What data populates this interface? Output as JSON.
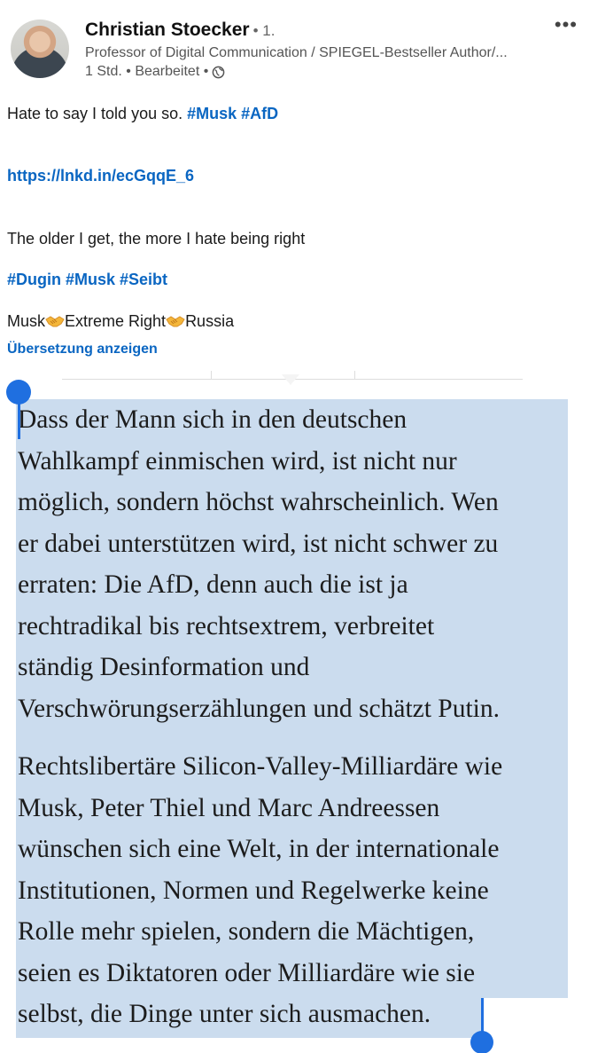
{
  "post": {
    "author_name": "Christian Stoecker",
    "degree": "• 1.",
    "headline": "Professor of Digital Communication / SPIEGEL-Bestseller Author/...",
    "time": "1 Std.",
    "separator": "•",
    "edited": "Bearbeitet",
    "separator2": "•",
    "more_label": "•••"
  },
  "body": {
    "line1_text": "Hate to say I told you so. ",
    "line1_tags": "#Musk #AfD",
    "link": "https://lnkd.in/ecGqqE_6",
    "line3": "The older I get, the more I hate being right",
    "tags2": "#Dugin #Musk #Seibt",
    "words": [
      "Musk",
      "Extreme Right",
      "Russia"
    ],
    "translate": "Übersetzung anzeigen"
  },
  "article": {
    "paragraph1": [
      "Dass der Mann sich in den deutschen",
      "Wahlkampf einmischen wird, ist nicht nur",
      "möglich, sondern höchst wahrscheinlich. Wen",
      "er dabei unterstützen wird, ist nicht schwer zu",
      "erraten: Die AfD, denn auch die ist ja",
      "rechtradikal bis rechtsextrem, verbreitet",
      "ständig Desinformation und",
      "Verschwörungserzählungen und schätzt Putin."
    ],
    "paragraph2": [
      "Rechtslibertäre Silicon-Valley-Milliardäre wie",
      "Musk, Peter Thiel und Marc Andreessen",
      "wünschen sich eine Welt, in der internationale",
      "Institutionen, Normen und Regelwerke keine",
      "Rolle mehr spielen, sondern die Mächtigen,",
      "seien es Diktatoren oder Milliardäre wie sie",
      "selbst, die Dinge unter sich ausmachen."
    ]
  },
  "colors": {
    "link": "#0a66c2",
    "selection": "#cbdcee",
    "handle": "#1f6fe0"
  },
  "icons": {
    "globe": "globe-icon",
    "handshake": "handshake-icon",
    "more": "more-icon"
  }
}
